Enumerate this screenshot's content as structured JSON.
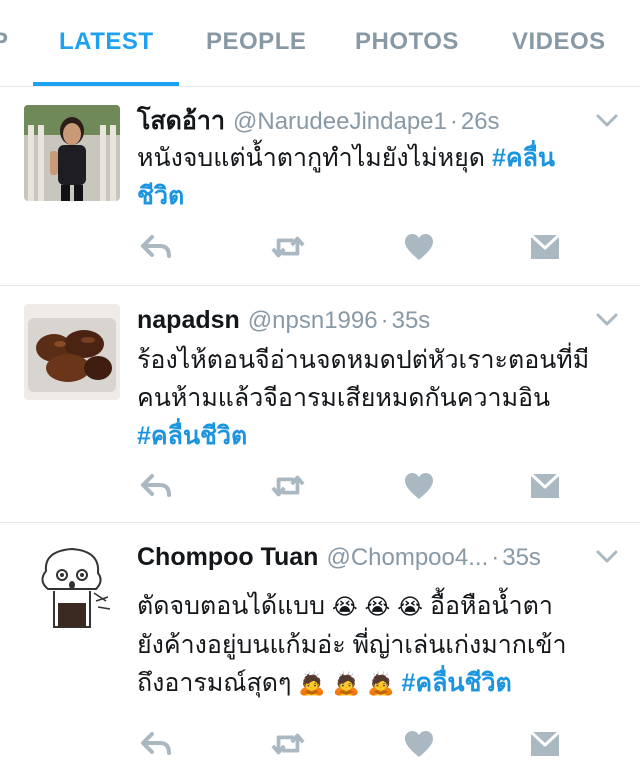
{
  "tabs": [
    {
      "label": "P"
    },
    {
      "label": "LATEST"
    },
    {
      "label": "PEOPLE"
    },
    {
      "label": "PHOTOS"
    },
    {
      "label": "VIDEOS"
    }
  ],
  "active_tab": "LATEST",
  "tweets": [
    {
      "name": "โสดอ้าา",
      "handle": "@NarudeeJindape1",
      "separator": "·",
      "time": "26s",
      "text_lines": [
        "หนังจบแต่น้ำตากูทำไมยังไม่หยุด"
      ],
      "hashtag_a": "#คลื่น",
      "hashtag_b": "ชีวิต",
      "avatar": "woman-photo"
    },
    {
      "name": "napadsn",
      "handle": "@npsn1996",
      "separator": "·",
      "time": "35s",
      "text_lines": [
        "ร้องไห้ตอนจีอ่านจดหมดปต่หัวเราะตอนที่มี",
        "คนห้ามแล้วจีอารมเสียหมดกันความอิน"
      ],
      "hashtag": "#คลื่นชีวิต",
      "avatar": "fried-chicken-photo"
    },
    {
      "name": "Chompoo Tuan",
      "handle": "@Chompoo4...",
      "separator": "·",
      "time": "35s",
      "text_line1": "ตัดจบตอนได้แบบ",
      "emoji_cry": "😭",
      "text_line1b": "อื้อหือน้ำตา",
      "text_line2": "ยังค้างอยู่บนแก้มอ่ะ พี่ญ่าเล่นเก่งมากเข้า",
      "text_line3": "ถึงอารมณ์สุดๆ",
      "emoji_bow": "🙇",
      "hashtag": "#คลื่นชีวิต",
      "avatar": "cartoon-girl-drawing"
    }
  ],
  "colors": {
    "accent": "#1da1f2",
    "hashtag": "#1b95e0",
    "muted": "#8899a6",
    "icon": "#aab8c2",
    "border": "#e1e8ed"
  },
  "icons": [
    "reply-icon",
    "retweet-icon",
    "like-icon",
    "dm-icon",
    "chevron-down-icon"
  ]
}
